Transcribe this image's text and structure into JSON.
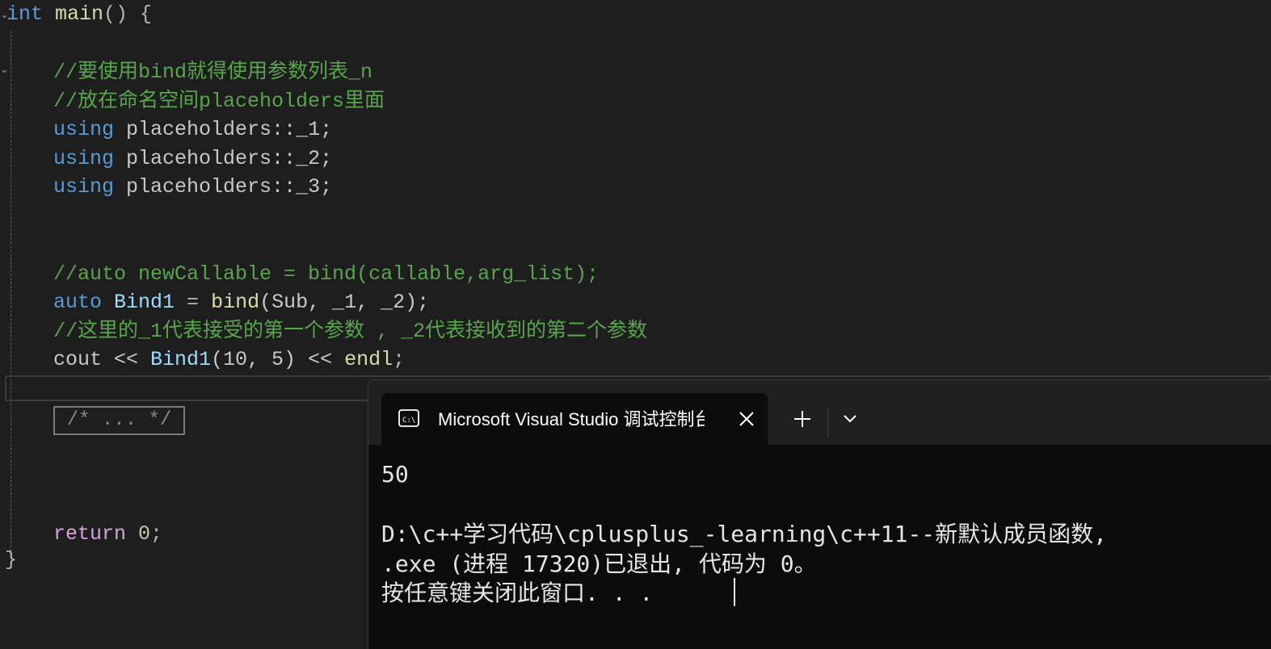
{
  "editor": {
    "code": {
      "main_kw": "int",
      "main_name": "main",
      "main_open": "() {",
      "comment1": "//要使用bind就得使用参数列表_n",
      "comment2": "//放在命名空间placeholders里面",
      "using_kw": "using",
      "using1": "placeholders::_1;",
      "using2": "placeholders::_2;",
      "using3": "placeholders::_3;",
      "comment3": "//auto newCallable = bind(callable,arg_list);",
      "auto_kw": "auto",
      "bind_var": "Bind1",
      "bind_eq": " = ",
      "bind_fn": "bind",
      "bind_args": "(Sub, _1, _2);",
      "comment4": "//这里的_1代表接受的第一个参数 , _2代表接收到的第二个参数",
      "cout_a": "cout << ",
      "cout_var": "Bind1",
      "cout_b": "(10, 5) << ",
      "cout_endl": "endl",
      "cout_semi": ";",
      "collapsed": "/* ... */",
      "return_kw": "return",
      "return_num": "0",
      "return_semi": ";",
      "close_brace": "}"
    }
  },
  "terminal": {
    "tab_title": "Microsoft Visual Studio 调试控制台",
    "tab_icon": "console-icon",
    "close_icon": "close-icon",
    "new_tab_icon": "plus-icon",
    "dropdown_icon": "chevron-down-icon",
    "output": [
      "50",
      "",
      "D:\\c++学习代码\\cplusplus_-learning\\c++11--新默认成员函数,",
      ".exe (进程 17320)已退出, 代码为 0。",
      "按任意键关闭此窗口. . ."
    ]
  }
}
